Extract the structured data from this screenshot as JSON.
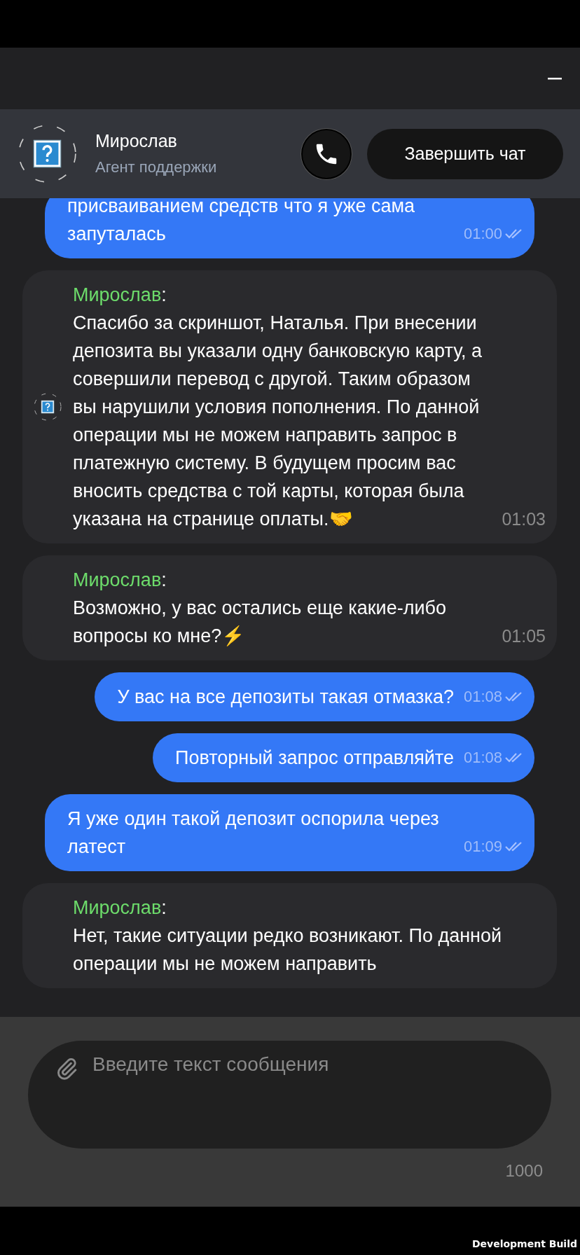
{
  "header": {
    "name": "Мирослав",
    "subtitle": "Агент поддержки",
    "end_chat_button": "Завершить чат"
  },
  "messages": [
    {
      "kind": "outgoing",
      "text": "присваиванием средств что я уже сама запуталась",
      "time": "01:00",
      "read": true
    },
    {
      "kind": "incoming",
      "sender": "Мирослав",
      "separator": ":",
      "show_avatar": true,
      "text": "Спасибо за скриншот, Наталья. При внесении депозита вы указали одну банковскую карту, а совершили перевод с другой. Таким образом вы нарушили условия пополнения. По данной операции мы не можем направить запрос в платежную систему. В будущем просим вас вносить средства с той карты, которая была указана на странице оплаты.🤝",
      "time": "01:03"
    },
    {
      "kind": "incoming",
      "sender": "Мирослав",
      "separator": ":",
      "show_avatar": false,
      "text": "Возможно, у вас остались еще какие-либо вопросы ко мне?⚡",
      "time": "01:05"
    },
    {
      "kind": "outgoing",
      "text": "У вас на все депозиты такая отмазка?",
      "time": "01:08",
      "read": true
    },
    {
      "kind": "outgoing",
      "text": "Повторный запрос отправляйте",
      "time": "01:08",
      "read": true
    },
    {
      "kind": "outgoing",
      "text": "Я уже один такой депозит оспорила через латест",
      "time": "01:09",
      "read": true
    },
    {
      "kind": "incoming",
      "sender": "Мирослав",
      "separator": ":",
      "show_avatar": false,
      "text": "Нет, такие ситуации редко возникают. По данной операции мы не можем направить"
    }
  ],
  "composer": {
    "placeholder": "Введите текст сообщения",
    "counter": "1000"
  },
  "footer": {
    "build_label": "Development Build"
  }
}
